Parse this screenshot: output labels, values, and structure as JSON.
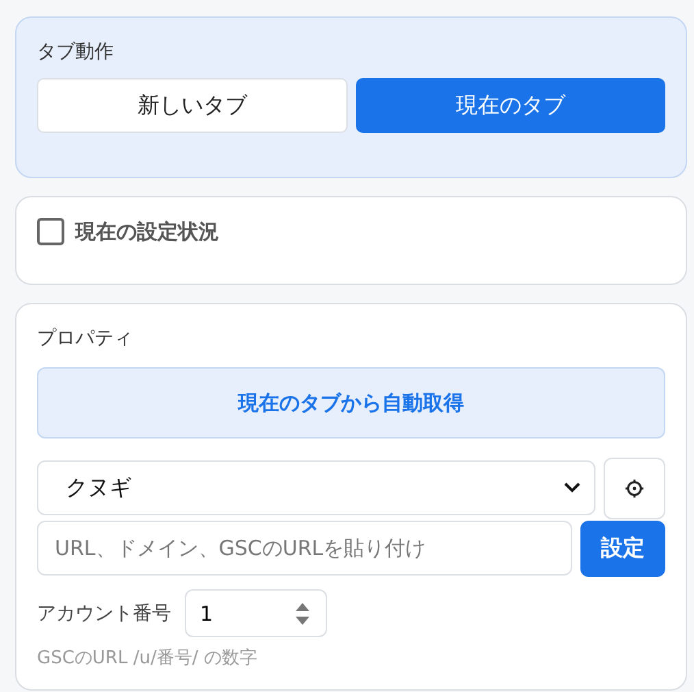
{
  "tab_action": {
    "title": "タブ動作",
    "options": [
      {
        "label": "新しいタブ",
        "selected": false
      },
      {
        "label": "現在のタブ",
        "selected": true
      }
    ]
  },
  "current_settings": {
    "label": "現在の設定状況",
    "checked": false
  },
  "property": {
    "title": "プロパティ",
    "auto_button": "現在のタブから自動取得",
    "select_value": "クヌギ",
    "url_placeholder": "URL、ドメイン、GSCのURLを貼り付け",
    "set_button": "設定",
    "account_label": "アカウント番号",
    "account_value": "1",
    "hint": "GSCのURL /u/番号/ の数字"
  }
}
